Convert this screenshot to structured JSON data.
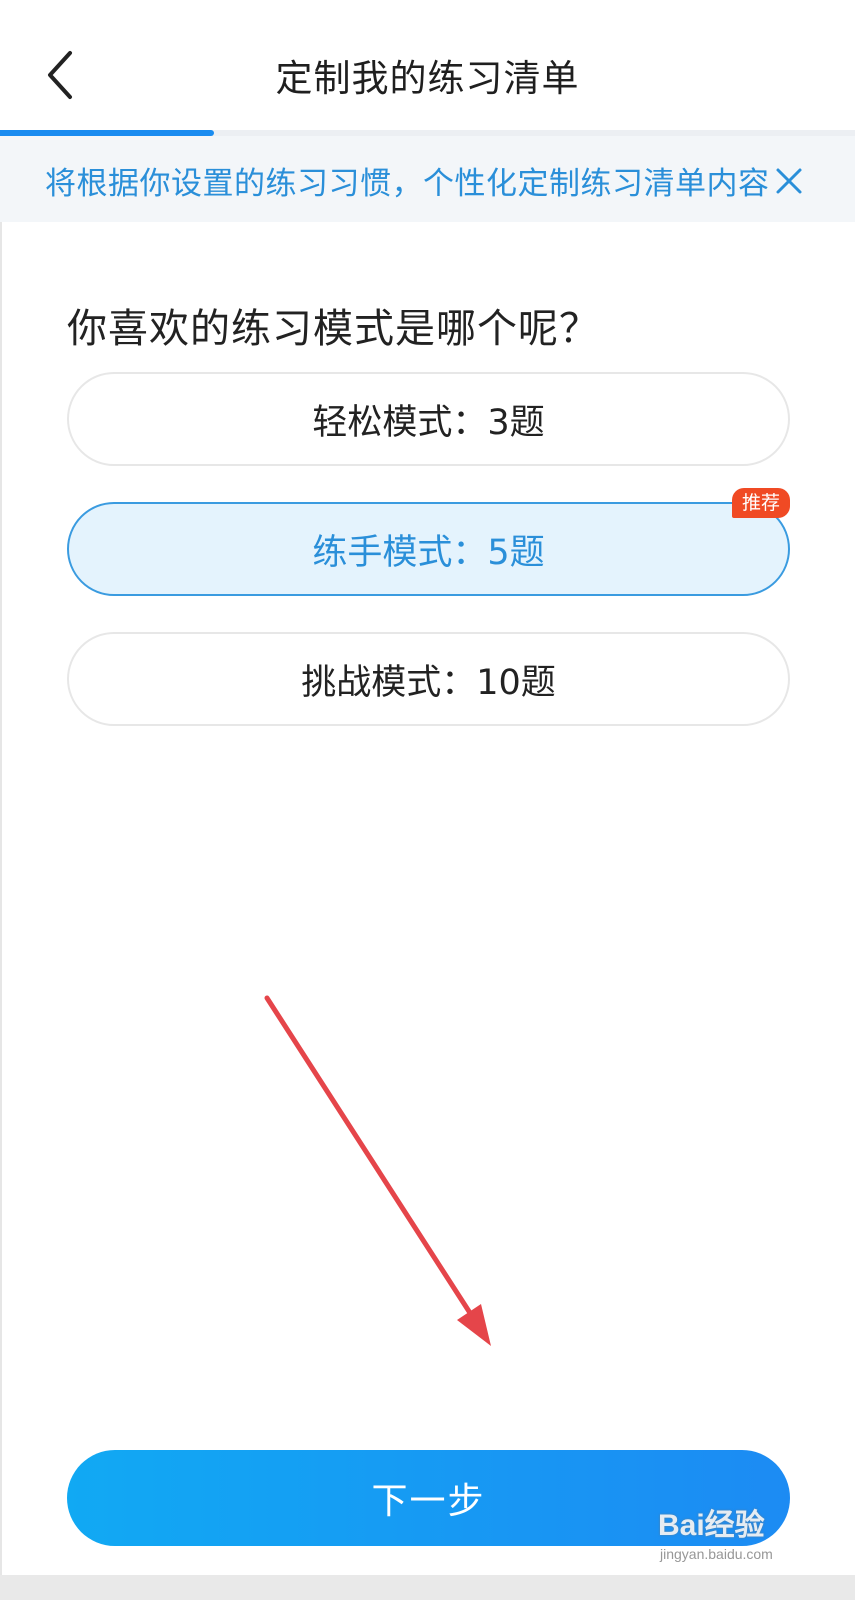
{
  "header": {
    "title": "定制我的练习清单"
  },
  "progress": {
    "value_percent": 25
  },
  "banner": {
    "text": "将根据你设置的练习习惯，个性化定制练习清单内容"
  },
  "question": {
    "text": "你喜欢的练习模式是哪个呢？"
  },
  "options": [
    {
      "label": "轻松模式：3题",
      "selected": false
    },
    {
      "label": "练手模式：5题",
      "selected": true,
      "badge": "推荐"
    },
    {
      "label": "挑战模式：10题",
      "selected": false
    }
  ],
  "footer": {
    "next_label": "下一步"
  },
  "watermark": {
    "main": "Bai经验",
    "sub": "jingyan.baidu.com"
  },
  "colors": {
    "accent": "#1a8cf0",
    "banner_text": "#2a8fd9",
    "badge": "#f04a24",
    "annotation_arrow": "#e5454a"
  },
  "icons": {
    "back": "chevron-left-icon",
    "close": "close-icon"
  }
}
